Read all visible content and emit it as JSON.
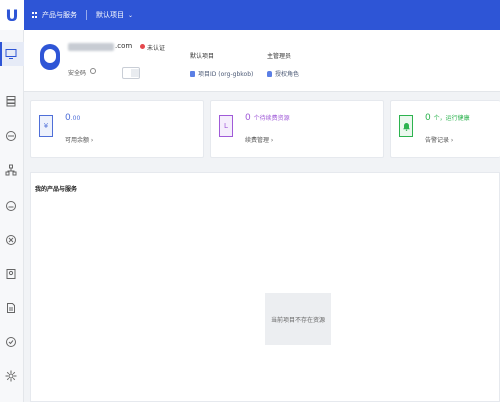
{
  "topbar": {
    "logo": "U",
    "products_label": "产品与服务",
    "project_label": "默认项目",
    "caret": "⌄"
  },
  "user": {
    "email_suffix": ".com",
    "verify_status": "未认证",
    "safety_label": "安全码",
    "info_icon": "info-icon"
  },
  "project": {
    "label": "默认项目",
    "value": "项目ID (org-gbkob)"
  },
  "admin": {
    "label": "主管理员",
    "value": "授权角色"
  },
  "stats": [
    {
      "icon": "¥",
      "value_main": "0",
      "value_sub": ".00",
      "value_suffix": "",
      "link": "可用余额  ›",
      "color": "#4f6fd8"
    },
    {
      "icon": "L",
      "value_main": "0",
      "value_sub": "",
      "value_suffix": "个待续费资源",
      "link": "续费管理  ›",
      "color": "#a05bd8"
    },
    {
      "icon": "bell-icon",
      "value_main": "0",
      "value_sub": "",
      "value_suffix": "个，运行健康",
      "link": "告警记录  ›",
      "color": "#2db34f"
    }
  ],
  "products": {
    "title": "我的产品与服务",
    "empty_text": "当前项目不存在资源"
  },
  "sidebar_icons": [
    "monitor-icon",
    "storage-icon",
    "network-icon",
    "org-icon",
    "cloud-icon",
    "database-icon",
    "badge-icon",
    "document-icon",
    "check-icon",
    "gear-icon"
  ]
}
